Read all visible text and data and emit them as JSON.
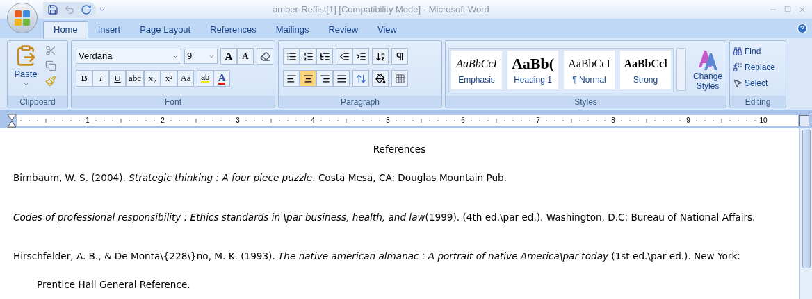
{
  "window": {
    "title": "amber-Reflist[1] [Compatibility Mode] - Microsoft Word"
  },
  "tabs": [
    {
      "label": "Home",
      "selected": true
    },
    {
      "label": "Insert",
      "selected": false
    },
    {
      "label": "Page Layout",
      "selected": false
    },
    {
      "label": "References",
      "selected": false
    },
    {
      "label": "Mailings",
      "selected": false
    },
    {
      "label": "Review",
      "selected": false
    },
    {
      "label": "View",
      "selected": false
    }
  ],
  "clipboard": {
    "label": "Clipboard",
    "paste": "Paste"
  },
  "font": {
    "label": "Font",
    "font_name": "Verdana",
    "font_size": "9",
    "grow": "A",
    "shrink": "A",
    "format_buttons": [
      "B",
      "I",
      "U",
      "abc",
      "x₂",
      "x²",
      "Aa"
    ],
    "highlight": "ab",
    "color_letter": "A"
  },
  "paragraph": {
    "label": "Paragraph",
    "alignment": [
      {
        "kind": "left",
        "selected": false
      },
      {
        "kind": "center",
        "selected": true
      },
      {
        "kind": "right",
        "selected": false
      },
      {
        "kind": "justify",
        "selected": false
      }
    ]
  },
  "styles": {
    "label": "Styles",
    "items": [
      {
        "preview": "AaBbCcI",
        "name": "Emphasis",
        "kind": "italic"
      },
      {
        "preview": "AaBb(",
        "name": "Heading 1",
        "kind": "heading"
      },
      {
        "preview": "AaBbCcI",
        "name": "¶ Normal",
        "kind": "normal"
      },
      {
        "preview": "AaBbCcl",
        "name": "Strong",
        "kind": "bold"
      }
    ],
    "change_styles": [
      "Change",
      "Styles"
    ]
  },
  "editing": {
    "label": "Editing",
    "find": "Find",
    "replace": "Replace",
    "select": "Select"
  },
  "ruler": {
    "numbers": [
      "1",
      "2",
      "3",
      "4",
      "5",
      "6",
      "7",
      "8",
      "9",
      "10"
    ]
  },
  "document": {
    "title": "References",
    "entries": [
      {
        "lines": [
          "Birnbaum, W. S. (2004). *Strategic thinking : A four piece puzzle*. Costa Mesa, CA: Douglas Mountain Pub."
        ]
      },
      {
        "lines": [
          "*Codes of professional responsibility : Ethics standards in \\par business, health, and law*(1999). (4th ed.\\par ed.). Washington, D.C: Bureau of National Affairs."
        ]
      },
      {
        "lines": [
          "Hirschfelder, A. B., & De Monta\\{228\\}no, M. K. (1993). *The native american almanac : A portrait of native America\\par today* (1st ed.\\par ed.). New York:",
          "Prentice Hall General Reference."
        ]
      }
    ]
  }
}
